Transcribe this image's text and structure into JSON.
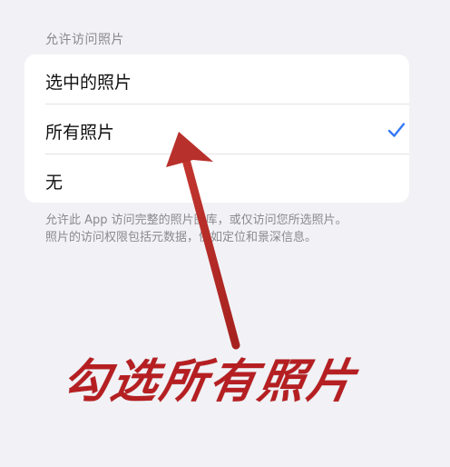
{
  "settings": {
    "section_header": "允许访问照片",
    "options": [
      {
        "label": "选中的照片",
        "selected": false
      },
      {
        "label": "所有照片",
        "selected": true
      },
      {
        "label": "无",
        "selected": false
      }
    ],
    "footnote": "允许此 App 访问完整的照片图库，或仅访问您所选照片。\n照片的访问权限包括元数据，例如定位和景深信息。",
    "check_icon": "checkmark-icon",
    "accent_color": "#3478f6"
  },
  "annotation": {
    "text": "勾选所有照片",
    "color": "#b51f22"
  }
}
